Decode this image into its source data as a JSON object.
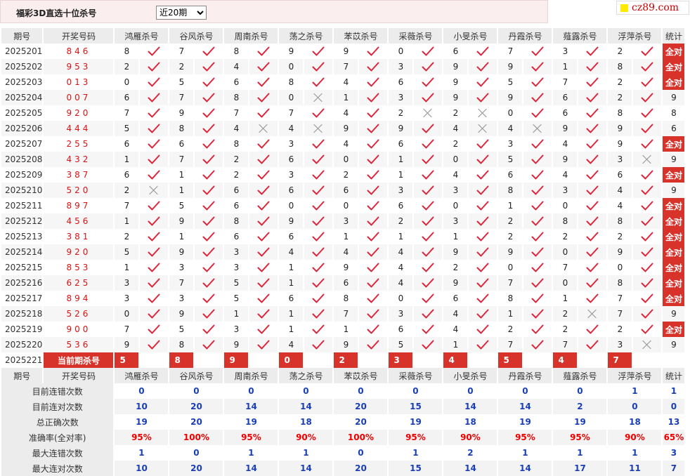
{
  "header": {
    "title": "福彩3D直选十位杀号",
    "period_select": "近20期",
    "logo": "cz89.com"
  },
  "columns": {
    "issue": "期号",
    "draw": "开奖号码",
    "stat": "统计",
    "predictors": [
      "鸿雁杀号",
      "谷风杀号",
      "周南杀号",
      "荡之杀号",
      "苯苡杀号",
      "采薇杀号",
      "小旻杀号",
      "丹霞杀号",
      "薤露杀号",
      "浮萍杀号"
    ]
  },
  "rows": [
    {
      "issue": "2025201",
      "draw": "846",
      "kill": [
        "8",
        "7",
        "8",
        "9",
        "9",
        "0",
        "6",
        "7",
        "3",
        "2"
      ],
      "ok": [
        1,
        1,
        1,
        1,
        1,
        1,
        1,
        1,
        1,
        1
      ],
      "stat": "全对"
    },
    {
      "issue": "2025202",
      "draw": "953",
      "kill": [
        "2",
        "2",
        "4",
        "0",
        "7",
        "3",
        "9",
        "9",
        "1",
        "8"
      ],
      "ok": [
        1,
        1,
        1,
        1,
        1,
        1,
        1,
        1,
        1,
        1
      ],
      "stat": "全对"
    },
    {
      "issue": "2025203",
      "draw": "013",
      "kill": [
        "0",
        "5",
        "6",
        "8",
        "4",
        "6",
        "9",
        "5",
        "7",
        "2"
      ],
      "ok": [
        1,
        1,
        1,
        1,
        1,
        1,
        1,
        1,
        1,
        1
      ],
      "stat": "全对"
    },
    {
      "issue": "2025204",
      "draw": "007",
      "kill": [
        "6",
        "7",
        "8",
        "0",
        "1",
        "3",
        "9",
        "9",
        "6",
        "2"
      ],
      "ok": [
        1,
        1,
        1,
        0,
        1,
        1,
        1,
        1,
        1,
        1
      ],
      "stat": "9"
    },
    {
      "issue": "2025205",
      "draw": "920",
      "kill": [
        "7",
        "9",
        "7",
        "7",
        "4",
        "2",
        "2",
        "0",
        "6",
        "8"
      ],
      "ok": [
        1,
        1,
        1,
        1,
        1,
        0,
        0,
        1,
        1,
        1
      ],
      "stat": "8"
    },
    {
      "issue": "2025206",
      "draw": "444",
      "kill": [
        "5",
        "8",
        "4",
        "4",
        "9",
        "9",
        "4",
        "4",
        "9",
        "9"
      ],
      "ok": [
        1,
        1,
        0,
        0,
        1,
        1,
        0,
        0,
        1,
        1
      ],
      "stat": "6"
    },
    {
      "issue": "2025207",
      "draw": "255",
      "kill": [
        "6",
        "6",
        "8",
        "3",
        "4",
        "6",
        "2",
        "3",
        "4",
        "9"
      ],
      "ok": [
        1,
        1,
        1,
        1,
        1,
        1,
        1,
        1,
        1,
        1
      ],
      "stat": "全对"
    },
    {
      "issue": "2025208",
      "draw": "432",
      "kill": [
        "1",
        "7",
        "2",
        "6",
        "0",
        "1",
        "0",
        "5",
        "9",
        "3"
      ],
      "ok": [
        1,
        1,
        1,
        1,
        1,
        1,
        1,
        1,
        1,
        0
      ],
      "stat": "9"
    },
    {
      "issue": "2025209",
      "draw": "387",
      "kill": [
        "6",
        "1",
        "2",
        "3",
        "2",
        "1",
        "4",
        "6",
        "4",
        "6"
      ],
      "ok": [
        1,
        1,
        1,
        1,
        1,
        1,
        1,
        1,
        1,
        1
      ],
      "stat": "全对"
    },
    {
      "issue": "2025210",
      "draw": "520",
      "kill": [
        "2",
        "1",
        "6",
        "6",
        "6",
        "3",
        "3",
        "8",
        "3",
        "4"
      ],
      "ok": [
        0,
        1,
        1,
        1,
        1,
        1,
        1,
        1,
        1,
        1
      ],
      "stat": "9"
    },
    {
      "issue": "2025211",
      "draw": "897",
      "kill": [
        "7",
        "5",
        "6",
        "0",
        "0",
        "6",
        "0",
        "1",
        "0",
        "4"
      ],
      "ok": [
        1,
        1,
        1,
        1,
        1,
        1,
        1,
        1,
        1,
        1
      ],
      "stat": "全对"
    },
    {
      "issue": "2025212",
      "draw": "456",
      "kill": [
        "1",
        "9",
        "8",
        "9",
        "3",
        "2",
        "3",
        "2",
        "8",
        "8"
      ],
      "ok": [
        1,
        1,
        1,
        1,
        1,
        1,
        1,
        1,
        1,
        1
      ],
      "stat": "全对"
    },
    {
      "issue": "2025213",
      "draw": "381",
      "kill": [
        "2",
        "1",
        "6",
        "6",
        "1",
        "1",
        "1",
        "2",
        "2",
        "2"
      ],
      "ok": [
        1,
        1,
        1,
        1,
        1,
        1,
        1,
        1,
        1,
        1
      ],
      "stat": "全对"
    },
    {
      "issue": "2025214",
      "draw": "920",
      "kill": [
        "5",
        "9",
        "3",
        "4",
        "4",
        "4",
        "9",
        "9",
        "0",
        "9"
      ],
      "ok": [
        1,
        1,
        1,
        1,
        1,
        1,
        1,
        1,
        1,
        1
      ],
      "stat": "全对"
    },
    {
      "issue": "2025215",
      "draw": "853",
      "kill": [
        "1",
        "3",
        "3",
        "1",
        "9",
        "4",
        "2",
        "0",
        "7",
        "0"
      ],
      "ok": [
        1,
        1,
        1,
        1,
        1,
        1,
        1,
        1,
        1,
        1
      ],
      "stat": "全对"
    },
    {
      "issue": "2025216",
      "draw": "625",
      "kill": [
        "3",
        "7",
        "5",
        "1",
        "6",
        "4",
        "9",
        "7",
        "0",
        "8"
      ],
      "ok": [
        1,
        1,
        1,
        1,
        1,
        1,
        1,
        1,
        1,
        1
      ],
      "stat": "全对"
    },
    {
      "issue": "2025217",
      "draw": "894",
      "kill": [
        "3",
        "3",
        "5",
        "6",
        "8",
        "0",
        "6",
        "8",
        "1",
        "7"
      ],
      "ok": [
        1,
        1,
        1,
        1,
        1,
        1,
        1,
        1,
        1,
        1
      ],
      "stat": "全对"
    },
    {
      "issue": "2025218",
      "draw": "526",
      "kill": [
        "0",
        "9",
        "1",
        "1",
        "7",
        "3",
        "4",
        "1",
        "2",
        "7"
      ],
      "ok": [
        1,
        1,
        1,
        1,
        1,
        1,
        1,
        1,
        0,
        1
      ],
      "stat": "9"
    },
    {
      "issue": "2025219",
      "draw": "900",
      "kill": [
        "7",
        "5",
        "3",
        "1",
        "1",
        "6",
        "4",
        "2",
        "2",
        "2"
      ],
      "ok": [
        1,
        1,
        1,
        1,
        1,
        1,
        1,
        1,
        1,
        1
      ],
      "stat": "全对"
    },
    {
      "issue": "2025220",
      "draw": "536",
      "kill": [
        "9",
        "8",
        "9",
        "4",
        "9",
        "5",
        "1",
        "7",
        "7",
        "3"
      ],
      "ok": [
        1,
        1,
        1,
        1,
        1,
        1,
        1,
        1,
        1,
        0
      ],
      "stat": "9"
    }
  ],
  "current": {
    "issue": "2025221",
    "label": "当前期杀号",
    "kill": [
      "5",
      "8",
      "9",
      "0",
      "2",
      "3",
      "4",
      "5",
      "4",
      "7"
    ]
  },
  "summary": [
    {
      "label": "目前连错次数",
      "values": [
        "0",
        "0",
        "0",
        "0",
        "0",
        "0",
        "0",
        "0",
        "0",
        "1"
      ],
      "stat": "1",
      "red": false
    },
    {
      "label": "目前连对次数",
      "values": [
        "10",
        "20",
        "14",
        "14",
        "20",
        "15",
        "14",
        "14",
        "2",
        "0"
      ],
      "stat": "0",
      "red": false
    },
    {
      "label": "总正确次数",
      "values": [
        "19",
        "20",
        "19",
        "18",
        "20",
        "19",
        "18",
        "19",
        "19",
        "18"
      ],
      "stat": "13",
      "red": false
    },
    {
      "label": "准确率(全对率)",
      "values": [
        "95%",
        "100%",
        "95%",
        "90%",
        "100%",
        "95%",
        "90%",
        "95%",
        "95%",
        "90%"
      ],
      "stat": "65%",
      "red": true
    },
    {
      "label": "最大连错次数",
      "values": [
        "1",
        "0",
        "1",
        "1",
        "0",
        "1",
        "2",
        "1",
        "1",
        "1"
      ],
      "stat": "3",
      "red": false
    },
    {
      "label": "最大连对次数",
      "values": [
        "10",
        "20",
        "14",
        "14",
        "20",
        "15",
        "14",
        "14",
        "17",
        "11"
      ],
      "stat": "7",
      "red": false
    }
  ]
}
